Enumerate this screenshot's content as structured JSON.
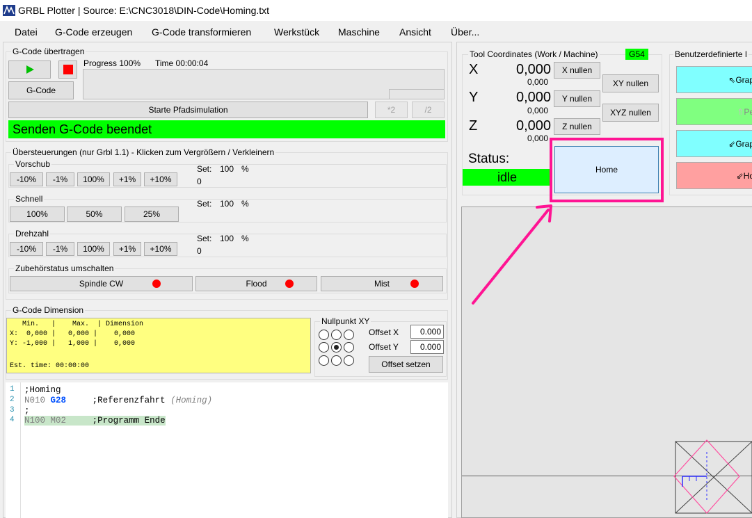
{
  "window": {
    "title": "GRBL Plotter | Source: E:\\CNC3018\\DIN-Code\\Homing.txt",
    "icon": "grbl-plotter-app-icon"
  },
  "menu": [
    "Datei",
    "G-Code erzeugen",
    "G-Code transformieren",
    "Werkstück",
    "Maschine",
    "Ansicht",
    "Über..."
  ],
  "gcode_transfer": {
    "group_label": "G-Code übertragen",
    "play_icon": "play-icon",
    "stop_icon": "stop-icon",
    "progress_label": "Progress 100%",
    "time_label": "Time 00:00:04",
    "progress": 1.0,
    "gcode_button": "G-Code",
    "simulate_button": "Starte Pfadsimulation",
    "times2_button": "*2",
    "div2_button": "/2",
    "status_message": "Senden G-Code beendet"
  },
  "overrides": {
    "group_label": "Übersteuerungen (nur Grbl 1.1) - Klicken zum Vergrößern / Verkleinern",
    "feed": {
      "label": "Vorschub",
      "buttons": [
        "-10%",
        "-1%",
        "100%",
        "+1%",
        "+10%"
      ],
      "set_label": "Set:",
      "set_value": "100",
      "set_unit": "%",
      "actual": "0"
    },
    "rapid": {
      "label": "Schnell",
      "buttons": [
        "100%",
        "50%",
        "25%"
      ],
      "set_label": "Set:",
      "set_value": "100",
      "set_unit": "%"
    },
    "spindle": {
      "label": "Drehzahl",
      "buttons": [
        "-10%",
        "-1%",
        "100%",
        "+1%",
        "+10%"
      ],
      "set_label": "Set:",
      "set_value": "100",
      "set_unit": "%",
      "actual": "0"
    },
    "accessory": {
      "label": "Zubehörstatus umschalten",
      "buttons": [
        "Spindle CW",
        "Flood",
        "Mist"
      ],
      "indicator_color": "#ff0000"
    }
  },
  "dimension": {
    "group_label": "G-Code Dimension",
    "header": "   Min.   |    Max.  | Dimension",
    "row_x": "X:  0,000 |   0,000 |    0,000",
    "row_y": "Y: -1,000 |   1,000 |    0,000",
    "est_time": "Est. time: 00:00:00"
  },
  "zero_xy": {
    "group_label": "Nullpunkt XY",
    "offset_x_label": "Offset X",
    "offset_x_value": "0.000",
    "offset_y_label": "Offset Y",
    "offset_y_value": "0.000",
    "set_button": "Offset setzen",
    "selected_radio": 4
  },
  "editor": {
    "lines": [
      {
        "num": "1",
        "text": ";Homing"
      },
      {
        "num": "2",
        "nword": "N010",
        "gword": "G28",
        "comment": ";Referenzfahrt",
        "paren": "(Homing)"
      },
      {
        "num": "3",
        "text": ";"
      },
      {
        "num": "4",
        "nword": "N100",
        "mword": "M02",
        "comment": ";Programm Ende"
      }
    ]
  },
  "coords": {
    "group_label": "Tool Coordinates (Work / Machine)",
    "wcs": "G54",
    "x_label": "X",
    "x_work": "0,000",
    "x_machine": "0,000",
    "x_zero_button": "X nullen",
    "y_label": "Y",
    "y_work": "0,000",
    "y_machine": "0,000",
    "y_zero_button": "Y nullen",
    "z_label": "Z",
    "z_work": "0,000",
    "z_machine": "0,000",
    "z_zero_button": "Z nullen",
    "xy_zero_button": "XY nullen",
    "xyz_zero_button": "XYZ nullen",
    "status_label": "Status:",
    "status_value": "idle",
    "home_button": "Home"
  },
  "custom_buttons": {
    "group_label": "Benutzerdefinierte I",
    "buttons": [
      {
        "label": "Grap",
        "icon": "arrow-up-left-icon",
        "color": "#80ffff"
      },
      {
        "label": "Pe",
        "icon": "arrow-up-icon",
        "color": "#80ff80"
      },
      {
        "label": "Grap",
        "icon": "arrow-down-left-icon",
        "color": "#80ffff"
      },
      {
        "label": "Ho",
        "icon": "arrow-down-left-icon",
        "color": "#ffa0a0"
      }
    ]
  },
  "colors": {
    "status_green": "#00ff00",
    "highlight_magenta": "#ff1493",
    "editor_highlight": "#c8e6c9"
  }
}
